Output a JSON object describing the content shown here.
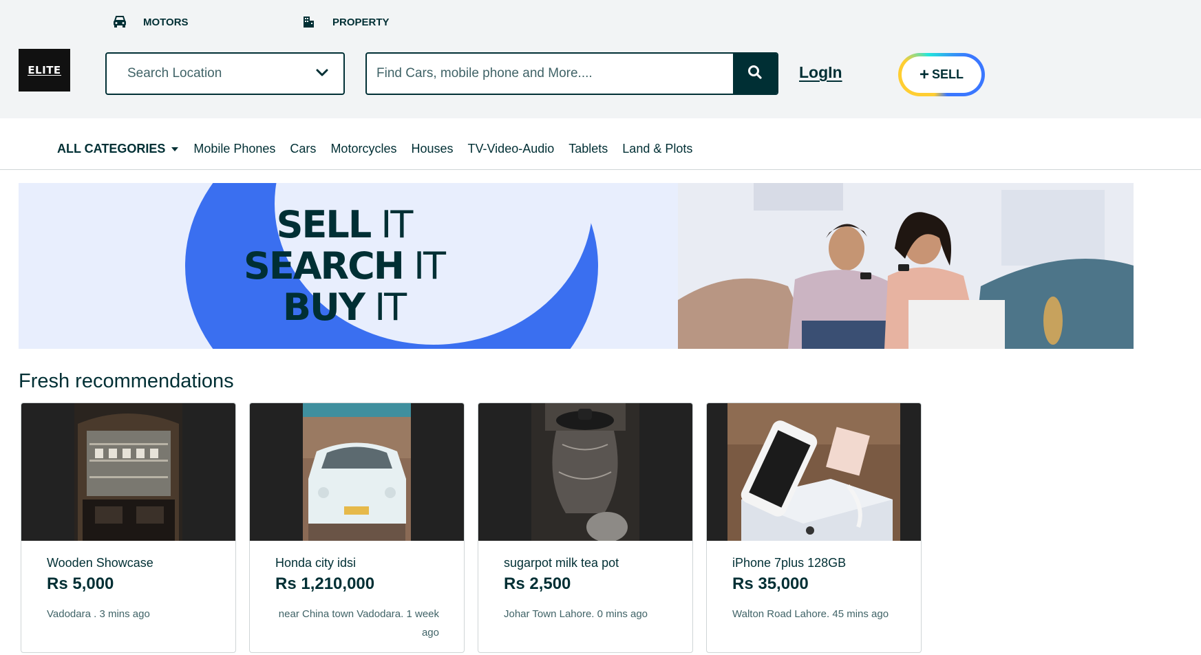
{
  "header": {
    "top_links": [
      {
        "label": "MOTORS",
        "icon": "car-icon"
      },
      {
        "label": "PROPERTY",
        "icon": "building-icon"
      }
    ],
    "logo_text": "ELITE",
    "location": {
      "placeholder": "Search Location"
    },
    "search": {
      "placeholder": "Find Cars, mobile phone and More...."
    },
    "login_label": "LogIn",
    "sell_label": "SELL"
  },
  "categories": {
    "all_label": "ALL CATEGORIES",
    "items": [
      "Mobile Phones",
      "Cars",
      "Motorcycles",
      "Houses",
      "TV-Video-Audio",
      "Tablets",
      "Land & Plots"
    ]
  },
  "banner": {
    "lines": [
      {
        "bold": "SELL",
        "rest": "IT"
      },
      {
        "bold": "SEARCH",
        "rest": "IT"
      },
      {
        "bold": "BUY",
        "rest": "IT"
      }
    ]
  },
  "recommendations": {
    "title": "Fresh recommendations",
    "items": [
      {
        "title": "Wooden Showcase",
        "price": "Rs 5,000",
        "meta": "Vadodara . 3 mins ago"
      },
      {
        "title": "Honda city idsi",
        "price": "Rs 1,210,000",
        "meta": "near China town Vadodara. 1 week ago"
      },
      {
        "title": "sugarpot milk tea pot",
        "price": "Rs 2,500",
        "meta": "Johar Town Lahore. 0 mins ago"
      },
      {
        "title": "iPhone 7plus 128GB",
        "price": "Rs 35,000",
        "meta": "Walton Road Lahore. 45 mins ago"
      }
    ]
  },
  "colors": {
    "primary": "#002f34",
    "header_bg": "#f2f4f5",
    "banner_blue": "#3a6ff0",
    "sell_border_yellow": "#ffce32",
    "sell_border_blue": "#3a77ff"
  }
}
